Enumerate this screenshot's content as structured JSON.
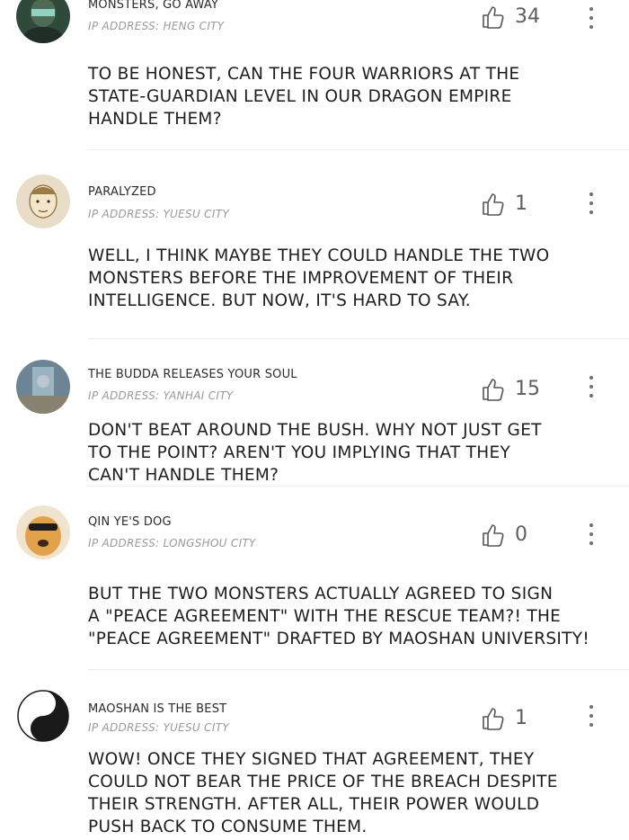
{
  "comments": [
    {
      "username": "MONSTERS, GO AWAY",
      "ip": "IP ADDRESS: HENG CITY",
      "likes": "34",
      "text": "TO BE HONEST, CAN THE FOUR WARRIORS AT THE\nSTATE-GUARDIAN LEVEL IN OUR DRAGON EMPIRE\nHANDLE THEM?",
      "avatar_icon": "masked-figure-avatar",
      "avatar_color": "#2f4a3a"
    },
    {
      "username": "PARALYZED",
      "ip": "IP ADDRESS: YUESU CITY",
      "likes": "1",
      "text": "WELL, I THINK MAYBE THEY COULD HANDLE THE TWO\nMONSTERS BEFORE THE IMPROVEMENT OF THEIR\nINTELLIGENCE. BUT NOW, IT'S HARD TO SAY.",
      "avatar_icon": "sketch-face-avatar",
      "avatar_color": "#d9c9a8"
    },
    {
      "username": "THE BUDDA RELEASES YOUR SOUL",
      "ip": "IP ADDRESS: YANHAI CITY",
      "likes": "15",
      "text": "DON'T BEAT AROUND THE BUSH. WHY NOT JUST GET\nTO THE POINT? AREN'T YOU IMPLYING THAT THEY\nCAN'T HANDLE THEM?",
      "avatar_icon": "blurred-photo-avatar",
      "avatar_color": "#7f98a8"
    },
    {
      "username": "QIN YE'S DOG",
      "ip": "IP ADDRESS: LONGSHOU CITY",
      "likes": "0",
      "text": "BUT THE TWO MONSTERS ACTUALLY AGREED TO SIGN\nA \"PEACE AGREEMENT\" WITH THE RESCUE TEAM?! THE\n\"PEACE AGREEMENT\" DRAFTED BY MAOSHAN UNIVERSITY!",
      "avatar_icon": "dog-sunglasses-avatar",
      "avatar_color": "#e3a24a"
    },
    {
      "username": "MAOSHAN IS THE BEST",
      "ip": "IP ADDRESS: YUESU CITY",
      "likes": "1",
      "text": "WOW! ONCE THEY SIGNED THAT AGREEMENT, THEY\nCOULD NOT BEAR THE PRICE OF THE BREACH DESPITE\nTHEIR STRENGTH. AFTER ALL, THEIR POWER WOULD\nPUSH BACK TO CONSUME THEM.",
      "avatar_icon": "yin-yang-avatar",
      "avatar_color": "#1a1a1a"
    }
  ],
  "icons": {
    "like": "thumbs-up-icon",
    "more": "more-vertical-icon"
  }
}
